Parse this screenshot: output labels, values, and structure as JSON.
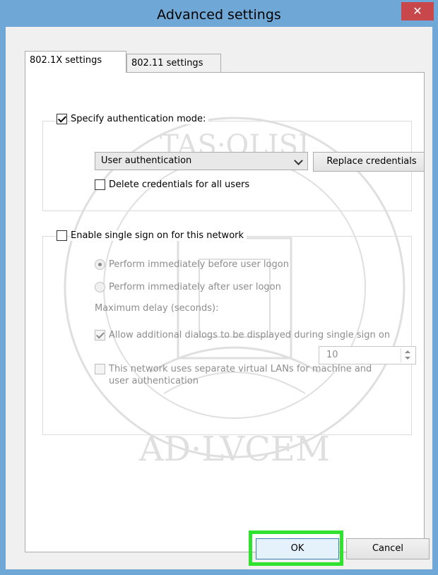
{
  "window": {
    "title": "Advanced settings",
    "close_glyph": "✕"
  },
  "tabs": [
    {
      "label": "802.1X settings",
      "active": true
    },
    {
      "label": "802.11 settings",
      "active": false
    }
  ],
  "auth_group": {
    "specify_mode_label": "Specify authentication mode:",
    "specify_mode_checked": true,
    "mode_selected": "User authentication",
    "replace_button": "Replace credentials",
    "delete_credentials_label": "Delete credentials for all users",
    "delete_credentials_checked": false
  },
  "sso_group": {
    "enable_label": "Enable single sign on for this network",
    "enable_checked": false,
    "radio_before": "Perform immediately before user logon",
    "radio_after": "Perform immediately after user logon",
    "radio_selected": "before",
    "max_delay_label": "Maximum delay (seconds):",
    "max_delay_value": "10",
    "allow_dialogs_label": "Allow additional dialogs to be displayed during single sign on",
    "allow_dialogs_checked": true,
    "vlan_label": "This network uses separate virtual LANs for machine and user authentication",
    "vlan_checked": false
  },
  "footer": {
    "ok_label": "OK",
    "cancel_label": "Cancel"
  },
  "watermark": {
    "text": "UNIVERSITAS · OLISIPONENSIS · AD · LVCEM"
  },
  "colors": {
    "titlebar": "#6fa8d6",
    "close": "#c7474a",
    "highlight": "#2ee22e"
  }
}
